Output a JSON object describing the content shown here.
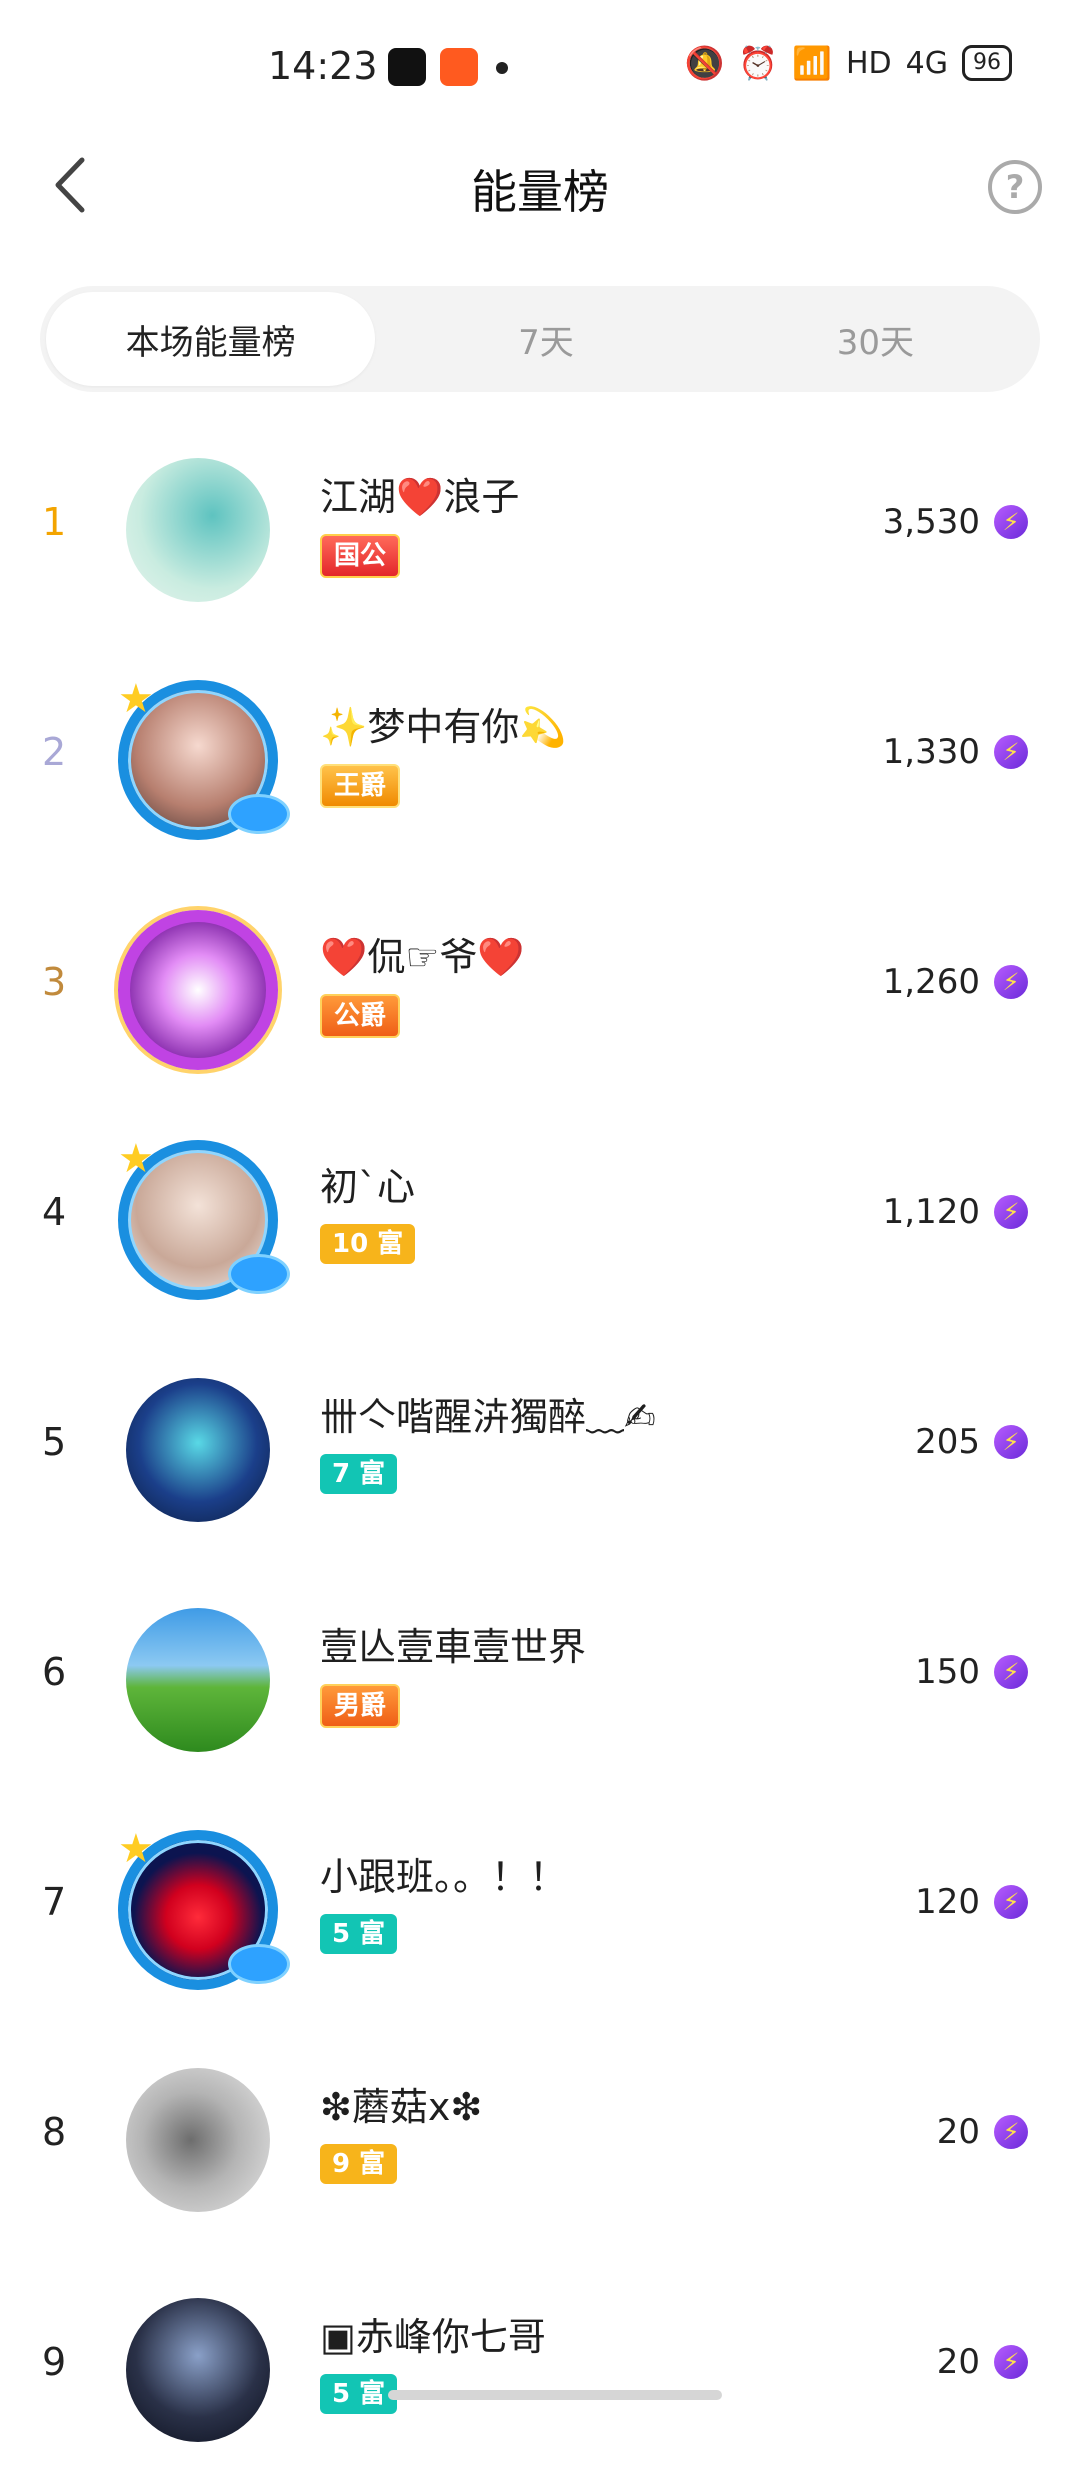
{
  "status_bar": {
    "time": "14:23",
    "icons": [
      "tiktok-icon",
      "kuaishou-icon",
      "silent-bell-icon",
      "alarm-icon",
      "wifi-icon",
      "signal-4g-icon",
      "battery-icon"
    ],
    "network": "HD",
    "signal": "4G",
    "battery": "96"
  },
  "header": {
    "title": "能量榜",
    "back_icon": "back-chevron-icon",
    "help_icon": "question-circle-icon"
  },
  "tabs": [
    {
      "label": "本场能量榜",
      "active": true
    },
    {
      "label": "7天",
      "active": false
    },
    {
      "label": "30天",
      "active": false
    }
  ],
  "ranking": [
    {
      "rank": "1",
      "name": "江湖❤️浪子",
      "badge": "国公",
      "score": "3,530"
    },
    {
      "rank": "2",
      "name": "✨梦中有你💫",
      "badge": "王爵",
      "score": "1,330"
    },
    {
      "rank": "3",
      "name": "❤️侃☞爷❤️",
      "badge": "公爵",
      "score": "1,260"
    },
    {
      "rank": "4",
      "name": "初`心",
      "badge": "10 富",
      "score": "1,120"
    },
    {
      "rank": "5",
      "name": "卌亽喈醒泋獨醉﹏✍",
      "badge": "7 富",
      "score": "205"
    },
    {
      "rank": "6",
      "name": "壹亾壹車壹世界",
      "badge": "男爵",
      "score": "150"
    },
    {
      "rank": "7",
      "name": "小跟班。。！！",
      "badge": "5 富",
      "score": "120"
    },
    {
      "rank": "8",
      "name": "❇蘑菇x❇",
      "badge": "9 富",
      "score": "20"
    },
    {
      "rank": "9",
      "name": "▣赤峰你七哥",
      "badge": "5 富",
      "score": "20"
    }
  ],
  "colors": {
    "rank_gold": "#f3a400",
    "rank_silver": "#a9a8d6",
    "rank_bronze": "#c18a3c",
    "badge_teal": "#12c5b4",
    "badge_yellow": "#f7b41b",
    "energy_purple": "#7b35e6"
  }
}
